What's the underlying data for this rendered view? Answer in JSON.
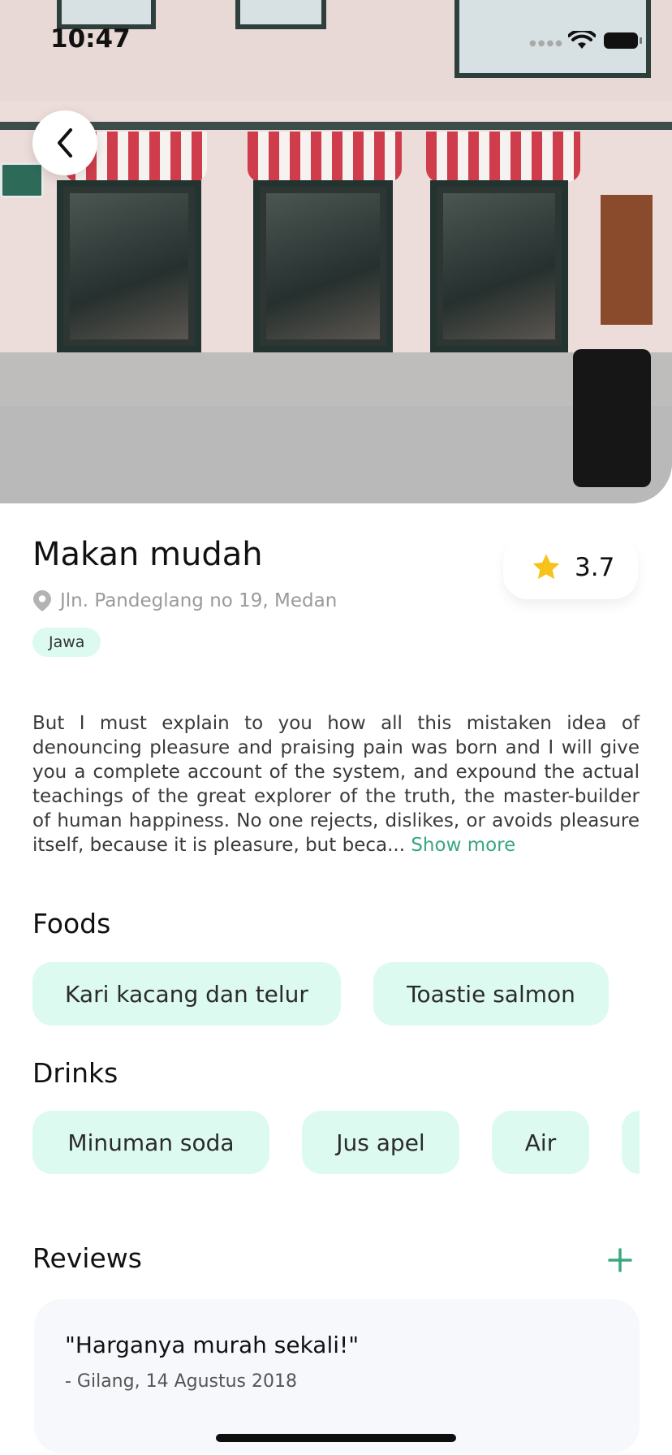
{
  "status_bar": {
    "time": "10:47"
  },
  "restaurant": {
    "name": "Makan mudah",
    "address": "Jln. Pandeglang no 19, Medan",
    "tag": "Jawa",
    "rating": "3.7",
    "description": "But I must explain to you how all this mistaken idea of denouncing pleasure and praising pain was born and I will give you a complete account of the system, and expound the actual teachings of the great explorer of the truth, the master-builder of human happiness. No one rejects, dislikes, or avoids pleasure itself, because it is pleasure, but beca...",
    "show_more": "Show more"
  },
  "foods": {
    "title": "Foods",
    "items": [
      "Kari kacang dan telur",
      "Toastie salmon"
    ]
  },
  "drinks": {
    "title": "Drinks",
    "items": [
      "Minuman soda",
      "Jus apel",
      "Air",
      ""
    ]
  },
  "reviews": {
    "title": "Reviews",
    "items": [
      {
        "quote": "\"Harganya murah sekali!\"",
        "author": "- Gilang, 14 Agustus 2018"
      }
    ]
  },
  "icons": {
    "back": "chevron-left-icon",
    "location": "location-pin-icon",
    "rating": "star-icon",
    "add": "plus-icon"
  },
  "colors": {
    "accent_green": "#3aa77f",
    "chip_background": "#dcfaef",
    "star": "#f7c21a"
  }
}
